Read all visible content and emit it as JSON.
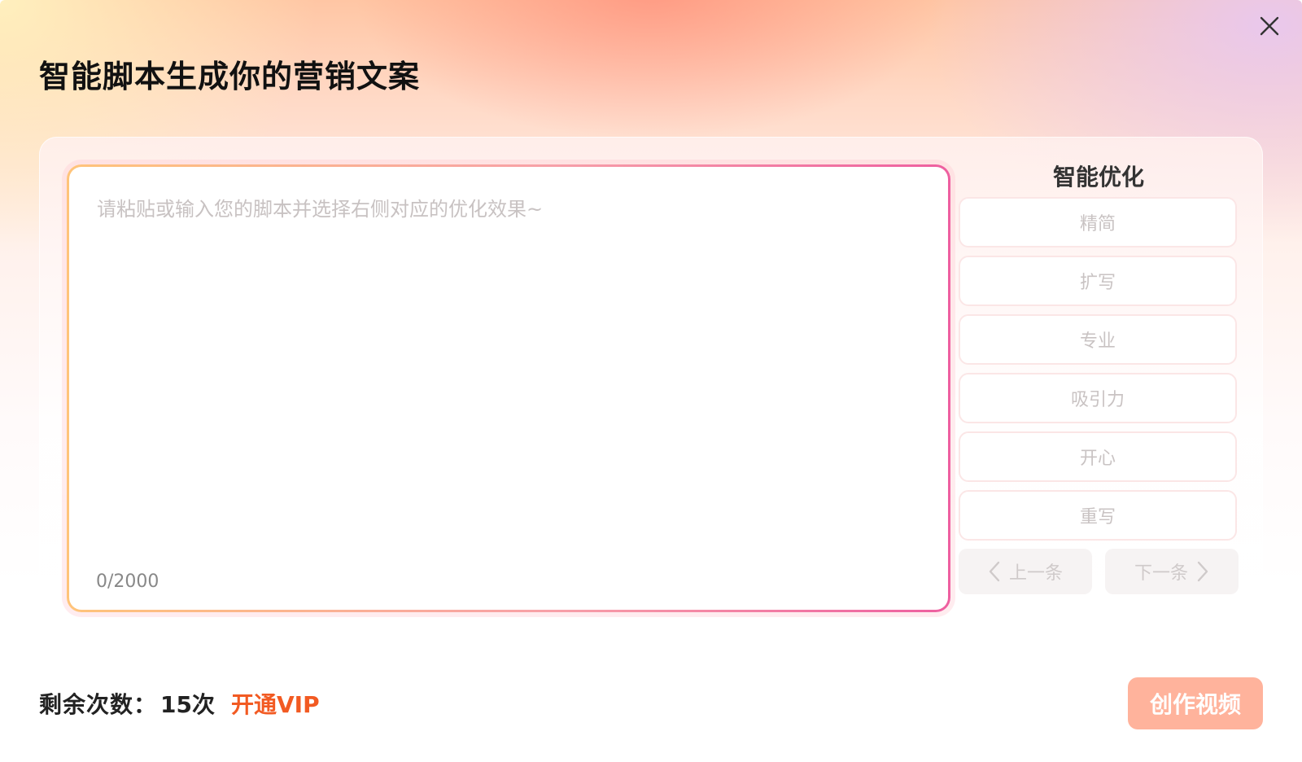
{
  "dialog": {
    "title": "智能脚本生成你的营销文案",
    "close_icon": "close-icon"
  },
  "editor": {
    "placeholder": "请粘贴或输入您的脚本并选择右侧对应的优化效果~",
    "value": "",
    "counter": "0/2000"
  },
  "optimize": {
    "title": "智能优化",
    "options": [
      {
        "label": "精简"
      },
      {
        "label": "扩写"
      },
      {
        "label": "专业"
      },
      {
        "label": "吸引力"
      },
      {
        "label": "开心"
      },
      {
        "label": "重写"
      }
    ],
    "prev_label": "上一条",
    "next_label": "下一条"
  },
  "footer": {
    "remain_label": "剩余次数：",
    "remain_value": "15次",
    "vip_label": "开通VIP",
    "create_label": "创作视频"
  },
  "colors": {
    "accent": "#f25a22",
    "create_button": "#ffb39c",
    "border_gradient_start": "#ffc47a",
    "border_gradient_end": "#ee5fa0"
  }
}
